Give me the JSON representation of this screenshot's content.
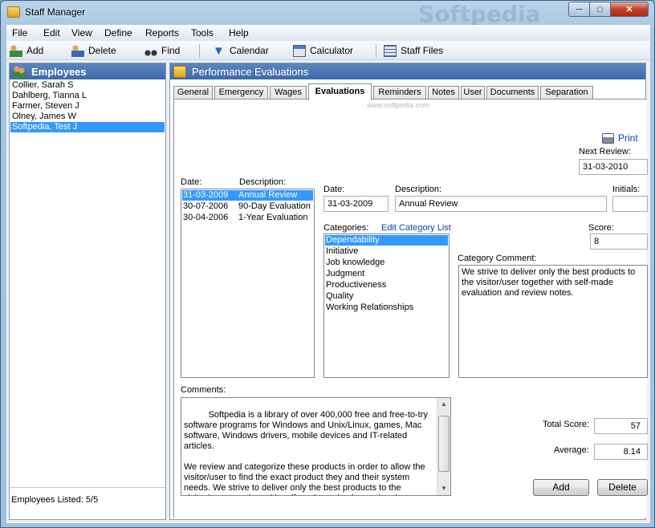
{
  "window": {
    "title": "Staff Manager",
    "watermark": "Softpedia"
  },
  "menu": [
    "File",
    "Edit",
    "View",
    "Define",
    "Reports",
    "Tools",
    "Help"
  ],
  "toolbar": {
    "add": "Add",
    "delete": "Delete",
    "find": "Find",
    "calendar": "Calendar",
    "calculator": "Calculator",
    "staff_files": "Staff Files"
  },
  "employees": {
    "header": "Employees",
    "items": [
      "Collier, Sarah S",
      "Dahlberg, Tianna L",
      "Farmer, Steven J",
      "Olney, James W",
      "Softpedia, Test J"
    ],
    "selected_index": 4,
    "footer": "Employees Listed: 5/5"
  },
  "evaluations_panel": {
    "header": "Performance Evaluations",
    "tabs": [
      "General",
      "Emergency",
      "Wages",
      "Evaluations",
      "Reminders",
      "Notes",
      "User",
      "Documents",
      "Separation"
    ],
    "active_tab": "Evaluations",
    "tab_watermark": "www.softpedia.com",
    "print_label": "Print",
    "next_review_label": "Next Review:",
    "next_review_value": "31-03-2010",
    "list_date_header": "Date:",
    "list_desc_header": "Description:",
    "evaluations": [
      {
        "date": "31-03-2009",
        "description": "Annual Review"
      },
      {
        "date": "30-07-2006",
        "description": "90-Day Evaluation"
      },
      {
        "date": "30-04-2006",
        "description": "1-Year Evaluation"
      }
    ],
    "selected_evaluation": 0,
    "date_label": "Date:",
    "date_value": "31-03-2009",
    "description_label": "Description:",
    "description_value": "Annual Review",
    "initials_label": "Initials:",
    "initials_value": "",
    "categories_label": "Categories:",
    "edit_category_link": "Edit Category List",
    "categories": [
      "Dependability",
      "Initiative",
      "Job knowledge",
      "Judgment",
      "Productiveness",
      "Quality",
      "Working Relationships"
    ],
    "selected_category": 0,
    "score_label": "Score:",
    "score_value": "8",
    "category_comment_label": "Category Comment:",
    "category_comment": "We strive to deliver only the best products to the visitor/user together with self-made evaluation and review notes.",
    "comments_label": "Comments:",
    "comments": "Softpedia is a library of over 400,000 free and free-to-try software programs for Windows and Unix/Linux, games, Mac software, Windows drivers, mobile devices and IT-related articles.\n\nWe review and categorize these products in order to allow the visitor/user to find the exact product they and their system needs. We strive to deliver only the best products to the visitor/user together with self-made evaluation and review",
    "total_score_label": "Total Score:",
    "total_score_value": "57",
    "average_label": "Average:",
    "average_value": "8.14",
    "add_button": "Add",
    "delete_button": "Delete"
  },
  "colors": {
    "selection": "#3399ff",
    "header": "#3d6aa8",
    "link": "#0645ad"
  }
}
